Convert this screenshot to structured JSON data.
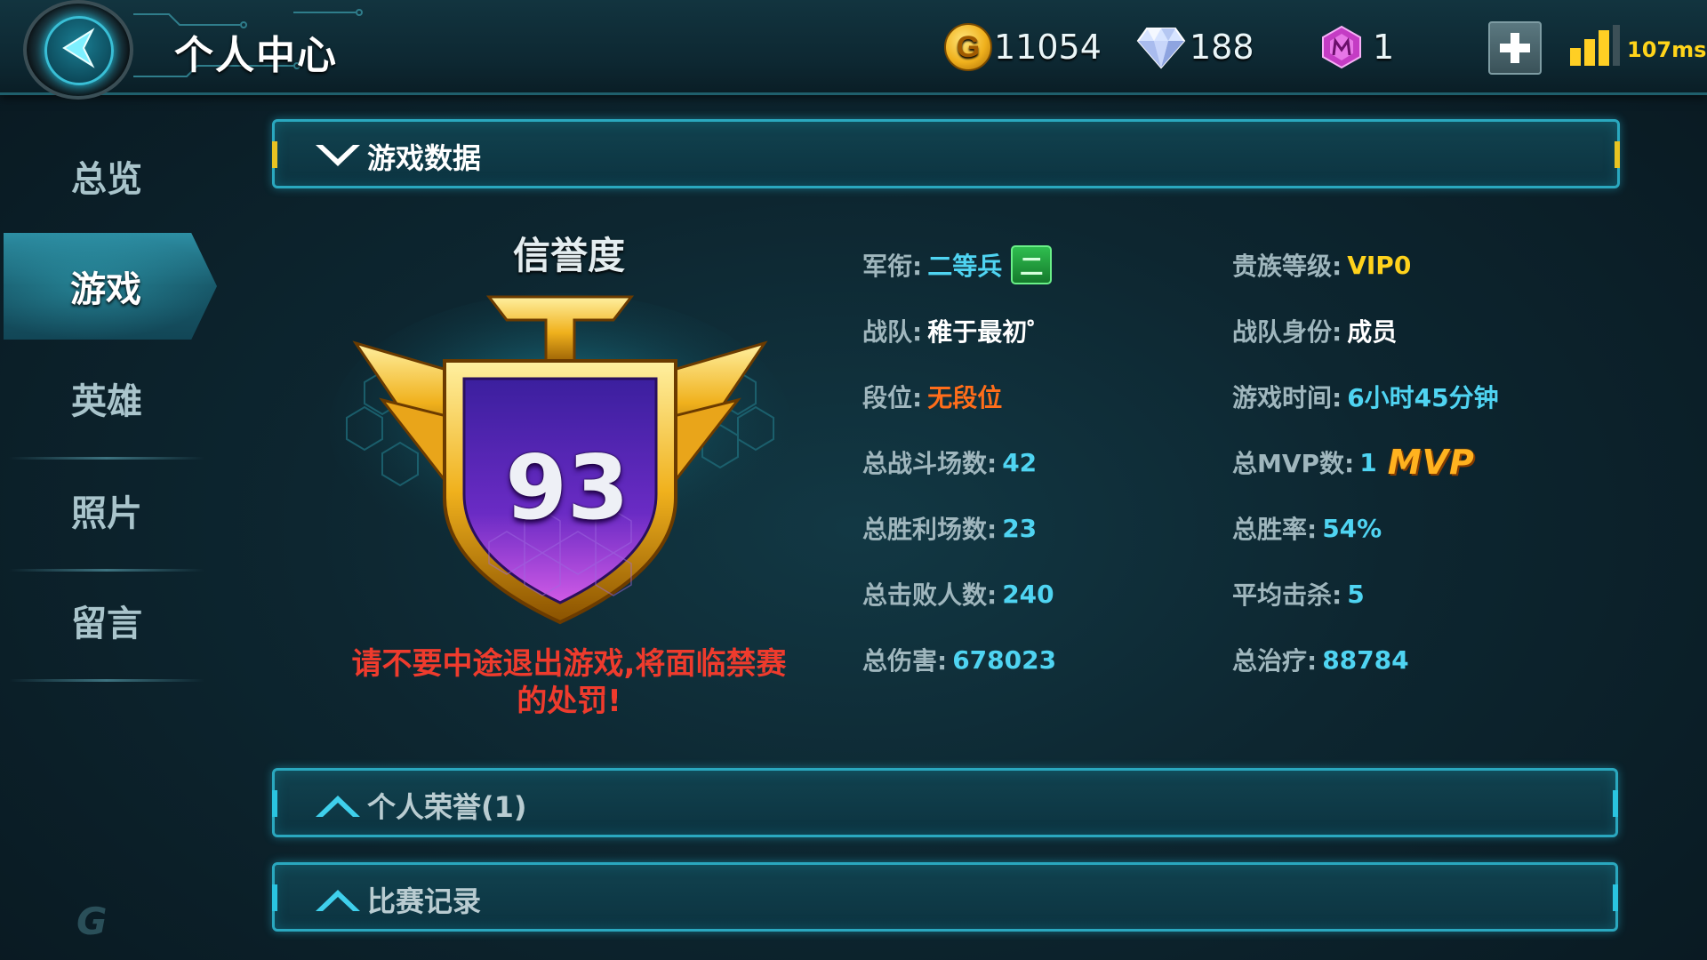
{
  "header": {
    "title": "个人中心",
    "gold": "11054",
    "diamonds": "188",
    "gems": "1",
    "ping": "107ms"
  },
  "sidebar": {
    "items": [
      {
        "label": "总览",
        "active": false
      },
      {
        "label": "游戏",
        "active": true
      },
      {
        "label": "英雄",
        "active": false
      },
      {
        "label": "照片",
        "active": false
      },
      {
        "label": "留言",
        "active": false
      }
    ]
  },
  "game_data": {
    "section_title": "游戏数据",
    "credit_title": "信誉度",
    "credit_score": "93",
    "warning": "请不要中途退出游戏,将面临禁赛的处罚!",
    "stats_left": [
      {
        "label": "军衔:",
        "value": "二等兵",
        "badge": "二"
      },
      {
        "label": "战队:",
        "value": "稚于最初゜"
      },
      {
        "label": "段位:",
        "value": "无段位"
      },
      {
        "label": "总战斗场数:",
        "value": "42"
      },
      {
        "label": "总胜利场数:",
        "value": "23"
      },
      {
        "label": "总击败人数:",
        "value": "240"
      },
      {
        "label": "总伤害:",
        "value": "678023"
      }
    ],
    "stats_right": [
      {
        "label": "贵族等级:",
        "value": "VIP0"
      },
      {
        "label": "战队身份:",
        "value": "成员"
      },
      {
        "label": "游戏时间:",
        "value": "6小时45分钟"
      },
      {
        "label": "总MVP数:",
        "value": "1",
        "badge": "MVP"
      },
      {
        "label": "总胜率:",
        "value": "54%"
      },
      {
        "label": "平均击杀:",
        "value": "5"
      },
      {
        "label": "总治疗:",
        "value": "88784"
      }
    ]
  },
  "sections": {
    "honors": "个人荣誉(1)",
    "matches": "比赛记录"
  },
  "colors": {
    "accent": "#2aa8bf",
    "value_blue": "#4fd4f2",
    "warning_red": "#ee3b2d",
    "rank_orange": "#ff6d1a",
    "vip_yellow": "#ffd21c",
    "badge_purple": "#6a2bc4",
    "badge_gold": "#f0b11d"
  },
  "icons": [
    "back-arrow-icon",
    "gold-coin-icon",
    "diamond-icon",
    "gem-icon",
    "plus-icon",
    "signal-icon",
    "chevron-down-icon",
    "chevron-up-icon",
    "credit-badge-icon",
    "rank-badge-icon",
    "mvp-icon"
  ]
}
